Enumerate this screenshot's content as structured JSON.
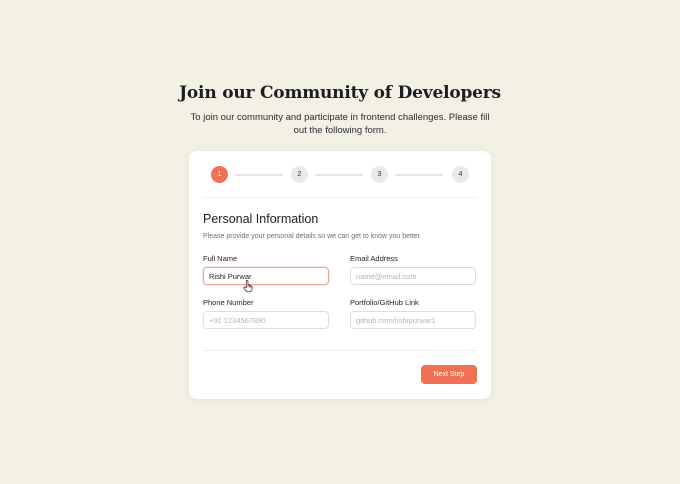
{
  "header": {
    "title": "Join our Community of Developers",
    "subtitle": "To join our community and participate in frontend challenges. Please fill out the following form."
  },
  "stepper": {
    "steps": [
      "1",
      "2",
      "3",
      "4"
    ],
    "active_step": 1,
    "active_color": "#f07153"
  },
  "section": {
    "title": "Personal Information",
    "description": "Please provide your personal details so we can get to know you better."
  },
  "form": {
    "full_name": {
      "label": "Full Name",
      "value": "Rishi Purwar",
      "placeholder": ""
    },
    "email": {
      "label": "Email Address",
      "value": "",
      "placeholder": "name@email.com"
    },
    "phone": {
      "label": "Phone Number",
      "value": "",
      "placeholder": "+91 1234567890"
    },
    "portfolio": {
      "label": "Portfolio/GitHub Link",
      "value": "",
      "placeholder": "github.com/rishipurwar1"
    }
  },
  "actions": {
    "next_label": "Next Step"
  },
  "icons": {
    "cursor": "hand-pointer-icon"
  }
}
